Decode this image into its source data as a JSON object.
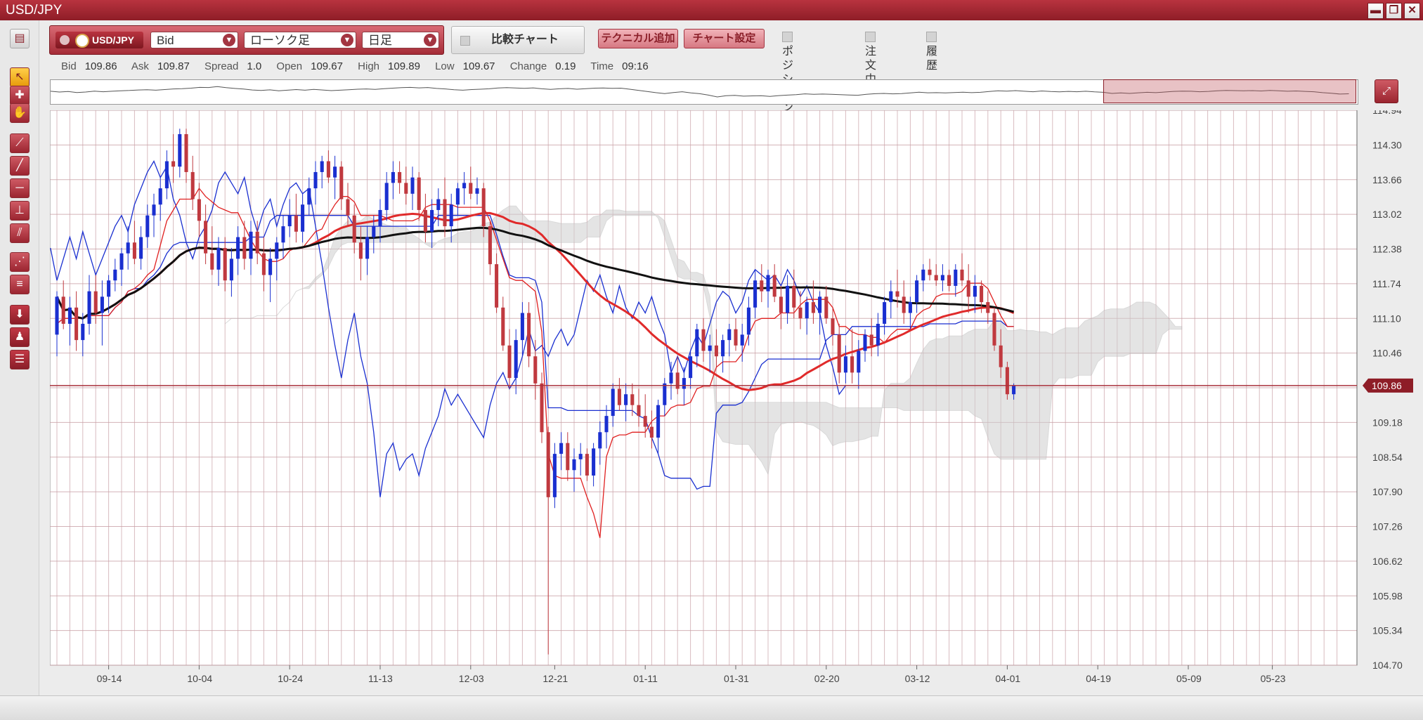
{
  "window": {
    "title": "USD/JPY",
    "controls": [
      "▬",
      "❐",
      "✕"
    ]
  },
  "toolbar": {
    "symbol": "USD/JPY",
    "price_type": "Bid",
    "chart_type": "ローソク足",
    "timeframe": "日足",
    "compare_label": "比較チャート",
    "add_technical_label": "テクニカル追加",
    "chart_settings_label": "チャート設定",
    "position_label": "ポジション",
    "orders_label": "注文中",
    "history_label": "履歴"
  },
  "quote": {
    "bid_label": "Bid",
    "bid": "109.86",
    "ask_label": "Ask",
    "ask": "109.87",
    "spread_label": "Spread",
    "spread": "1.0",
    "open_label": "Open",
    "open": "109.67",
    "high_label": "High",
    "high": "109.89",
    "low_label": "Low",
    "low": "109.67",
    "change_label": "Change",
    "change": "0.19",
    "time_label": "Time",
    "time": "09:16"
  },
  "left_tools": [
    "cursor-icon",
    "crosshair-icon",
    "hand-icon",
    "trendline-icon",
    "line-icon",
    "horizontal-line-icon",
    "vertical-line-icon",
    "channel-icon",
    "fibonacci-icon",
    "text-icon",
    "arrow-down-icon",
    "bell-icon",
    "list-icon"
  ],
  "chart_data": {
    "type": "candlestick",
    "symbol": "USD/JPY",
    "y_ticks": [
      "114.94",
      "114.30",
      "113.66",
      "113.02",
      "112.38",
      "111.74",
      "111.10",
      "110.46",
      "109.82",
      "109.18",
      "108.54",
      "107.90",
      "107.26",
      "106.62",
      "105.98",
      "105.34",
      "104.70"
    ],
    "ylim": [
      104.7,
      114.94
    ],
    "x_ticks": [
      "09-14",
      "10-04",
      "10-24",
      "11-13",
      "12-03",
      "12-21",
      "01-11",
      "01-31",
      "02-20",
      "03-12",
      "04-01",
      "04-19",
      "05-09",
      "05-23"
    ],
    "last_price_label": "109.86",
    "last_price": 109.86,
    "candles": [
      [
        110.8,
        111.6,
        110.4,
        111.5
      ],
      [
        111.5,
        111.8,
        110.9,
        111.0
      ],
      [
        111.0,
        111.5,
        110.6,
        111.3
      ],
      [
        111.3,
        111.6,
        110.5,
        110.7
      ],
      [
        110.7,
        111.2,
        110.4,
        111.0
      ],
      [
        111.0,
        111.9,
        110.8,
        111.6
      ],
      [
        111.6,
        111.9,
        111.0,
        111.2
      ],
      [
        111.2,
        111.8,
        110.6,
        111.5
      ],
      [
        111.5,
        111.9,
        111.2,
        111.8
      ],
      [
        111.8,
        112.2,
        111.6,
        112.0
      ],
      [
        112.0,
        112.4,
        111.7,
        112.3
      ],
      [
        112.3,
        112.8,
        112.0,
        112.5
      ],
      [
        112.5,
        112.9,
        112.1,
        112.2
      ],
      [
        112.2,
        112.8,
        112.0,
        112.6
      ],
      [
        112.6,
        113.2,
        112.4,
        113.0
      ],
      [
        113.0,
        113.4,
        112.6,
        113.2
      ],
      [
        113.2,
        113.7,
        112.9,
        113.5
      ],
      [
        113.5,
        114.2,
        113.3,
        114.0
      ],
      [
        114.0,
        114.5,
        113.6,
        113.9
      ],
      [
        113.9,
        114.6,
        113.7,
        114.5
      ],
      [
        114.5,
        114.6,
        113.6,
        113.8
      ],
      [
        113.8,
        114.1,
        113.1,
        113.3
      ],
      [
        113.3,
        113.6,
        112.6,
        112.9
      ],
      [
        112.9,
        113.2,
        112.1,
        112.3
      ],
      [
        112.3,
        112.8,
        111.9,
        112.0
      ],
      [
        112.0,
        112.6,
        111.7,
        112.4
      ],
      [
        112.4,
        112.6,
        111.6,
        111.8
      ],
      [
        111.8,
        112.4,
        111.5,
        112.2
      ],
      [
        112.2,
        112.8,
        111.9,
        112.6
      ],
      [
        112.6,
        112.9,
        112.0,
        112.2
      ],
      [
        112.2,
        112.9,
        111.9,
        112.7
      ],
      [
        112.7,
        112.9,
        112.1,
        112.3
      ],
      [
        112.3,
        112.6,
        111.6,
        111.9
      ],
      [
        111.9,
        112.4,
        111.4,
        112.2
      ],
      [
        112.2,
        112.6,
        111.8,
        112.5
      ],
      [
        112.5,
        113.0,
        112.2,
        112.8
      ],
      [
        112.8,
        113.3,
        112.6,
        113.0
      ],
      [
        113.0,
        113.4,
        112.5,
        112.7
      ],
      [
        112.7,
        113.4,
        112.5,
        113.2
      ],
      [
        113.2,
        113.7,
        113.0,
        113.5
      ],
      [
        113.5,
        114.0,
        113.2,
        113.8
      ],
      [
        113.8,
        114.1,
        113.5,
        114.0
      ],
      [
        114.0,
        114.2,
        113.6,
        113.7
      ],
      [
        113.7,
        114.1,
        113.3,
        113.9
      ],
      [
        113.9,
        114.0,
        113.1,
        113.3
      ],
      [
        113.3,
        113.6,
        112.8,
        113.0
      ],
      [
        113.0,
        113.2,
        112.3,
        112.5
      ],
      [
        112.5,
        112.8,
        111.8,
        112.2
      ],
      [
        112.2,
        112.8,
        111.9,
        112.6
      ],
      [
        112.6,
        113.0,
        112.3,
        112.8
      ],
      [
        112.8,
        113.3,
        112.5,
        113.1
      ],
      [
        113.1,
        113.8,
        112.9,
        113.6
      ],
      [
        113.6,
        114.0,
        113.3,
        113.8
      ],
      [
        113.8,
        114.0,
        113.4,
        113.6
      ],
      [
        113.6,
        113.9,
        113.2,
        113.4
      ],
      [
        113.4,
        113.9,
        113.1,
        113.7
      ],
      [
        113.7,
        113.8,
        112.9,
        113.1
      ],
      [
        113.1,
        113.4,
        112.5,
        112.7
      ],
      [
        112.7,
        113.3,
        112.4,
        113.1
      ],
      [
        113.1,
        113.5,
        112.8,
        113.3
      ],
      [
        113.3,
        113.7,
        112.6,
        112.8
      ],
      [
        112.8,
        113.4,
        112.5,
        113.2
      ],
      [
        113.2,
        113.6,
        113.0,
        113.5
      ],
      [
        113.5,
        113.8,
        113.2,
        113.6
      ],
      [
        113.6,
        113.9,
        113.3,
        113.4
      ],
      [
        113.4,
        113.7,
        113.2,
        113.5
      ],
      [
        113.5,
        113.6,
        112.6,
        112.8
      ],
      [
        112.8,
        112.9,
        111.9,
        112.1
      ],
      [
        112.1,
        112.3,
        111.2,
        111.3
      ],
      [
        111.3,
        111.5,
        110.5,
        110.6
      ],
      [
        110.6,
        110.9,
        109.8,
        110.0
      ],
      [
        110.0,
        110.9,
        109.7,
        110.7
      ],
      [
        110.7,
        111.4,
        110.4,
        111.2
      ],
      [
        111.2,
        111.4,
        110.2,
        110.4
      ],
      [
        110.4,
        110.7,
        109.6,
        109.9
      ],
      [
        109.9,
        110.1,
        108.8,
        109.0
      ],
      [
        109.0,
        109.1,
        104.9,
        107.8
      ],
      [
        107.8,
        108.8,
        107.6,
        108.6
      ],
      [
        108.6,
        109.0,
        108.3,
        108.8
      ],
      [
        108.8,
        109.0,
        108.1,
        108.3
      ],
      [
        108.3,
        108.7,
        107.9,
        108.5
      ],
      [
        108.5,
        108.8,
        108.2,
        108.6
      ],
      [
        108.6,
        108.7,
        108.1,
        108.2
      ],
      [
        108.2,
        108.8,
        108.0,
        108.7
      ],
      [
        108.7,
        109.2,
        108.4,
        109.0
      ],
      [
        109.0,
        109.5,
        108.7,
        109.3
      ],
      [
        109.3,
        109.9,
        109.1,
        109.8
      ],
      [
        109.8,
        110.0,
        109.4,
        109.5
      ],
      [
        109.5,
        109.9,
        109.2,
        109.7
      ],
      [
        109.7,
        109.9,
        109.3,
        109.5
      ],
      [
        109.5,
        109.8,
        109.1,
        109.3
      ],
      [
        109.3,
        109.7,
        108.9,
        109.1
      ],
      [
        109.1,
        109.4,
        108.7,
        108.9
      ],
      [
        108.9,
        109.6,
        108.6,
        109.5
      ],
      [
        109.5,
        110.0,
        109.3,
        109.9
      ],
      [
        109.9,
        110.3,
        109.6,
        110.1
      ],
      [
        110.1,
        110.4,
        109.7,
        109.8
      ],
      [
        109.8,
        110.2,
        109.5,
        110.0
      ],
      [
        110.0,
        110.5,
        109.8,
        110.4
      ],
      [
        110.4,
        111.0,
        110.2,
        110.9
      ],
      [
        110.9,
        111.1,
        110.3,
        110.5
      ],
      [
        110.5,
        110.8,
        110.1,
        110.6
      ],
      [
        110.6,
        110.9,
        110.2,
        110.4
      ],
      [
        110.4,
        110.8,
        110.1,
        110.7
      ],
      [
        110.7,
        111.0,
        110.4,
        110.9
      ],
      [
        110.9,
        111.1,
        110.5,
        110.6
      ],
      [
        110.6,
        111.0,
        110.3,
        110.8
      ],
      [
        110.8,
        111.5,
        110.6,
        111.3
      ],
      [
        111.3,
        112.0,
        111.1,
        111.8
      ],
      [
        111.8,
        112.1,
        111.4,
        111.6
      ],
      [
        111.6,
        112.0,
        111.3,
        111.9
      ],
      [
        111.9,
        112.1,
        111.4,
        111.5
      ],
      [
        111.5,
        111.7,
        110.9,
        111.2
      ],
      [
        111.2,
        111.9,
        111.0,
        111.7
      ],
      [
        111.7,
        112.0,
        111.1,
        111.3
      ],
      [
        111.3,
        111.6,
        110.9,
        111.1
      ],
      [
        111.1,
        111.5,
        110.8,
        111.4
      ],
      [
        111.4,
        111.8,
        111.0,
        111.2
      ],
      [
        111.2,
        111.6,
        110.8,
        111.5
      ],
      [
        111.5,
        111.7,
        111.0,
        111.1
      ],
      [
        111.1,
        111.3,
        110.6,
        110.8
      ],
      [
        110.8,
        111.0,
        109.9,
        110.1
      ],
      [
        110.1,
        110.6,
        109.9,
        110.4
      ],
      [
        110.4,
        110.9,
        109.9,
        110.1
      ],
      [
        110.1,
        110.7,
        109.8,
        110.5
      ],
      [
        110.5,
        110.9,
        110.3,
        110.8
      ],
      [
        110.8,
        111.1,
        110.4,
        110.6
      ],
      [
        110.6,
        111.2,
        110.4,
        111.0
      ],
      [
        111.0,
        111.5,
        110.8,
        111.4
      ],
      [
        111.4,
        111.8,
        111.1,
        111.6
      ],
      [
        111.6,
        112.0,
        111.3,
        111.5
      ],
      [
        111.5,
        111.8,
        111.0,
        111.2
      ],
      [
        111.2,
        111.5,
        110.9,
        111.4
      ],
      [
        111.4,
        111.9,
        111.2,
        111.8
      ],
      [
        111.8,
        112.1,
        111.6,
        112.0
      ],
      [
        112.0,
        112.2,
        111.8,
        111.9
      ],
      [
        111.9,
        112.1,
        111.7,
        111.8
      ],
      [
        111.8,
        112.1,
        111.6,
        111.9
      ],
      [
        111.9,
        112.0,
        111.6,
        111.7
      ],
      [
        111.7,
        112.1,
        111.5,
        112.0
      ],
      [
        112.0,
        112.3,
        111.7,
        111.8
      ],
      [
        111.8,
        112.1,
        111.2,
        111.5
      ],
      [
        111.5,
        111.9,
        111.2,
        111.7
      ],
      [
        111.7,
        111.8,
        111.2,
        111.4
      ],
      [
        111.4,
        111.6,
        111.0,
        111.2
      ],
      [
        111.2,
        111.3,
        110.5,
        110.6
      ],
      [
        110.6,
        110.9,
        110.0,
        110.2
      ],
      [
        110.2,
        110.3,
        109.6,
        109.7
      ],
      [
        109.7,
        109.9,
        109.6,
        109.86
      ]
    ],
    "x_tick_index": [
      8,
      22,
      36,
      50,
      64,
      77,
      91,
      105,
      119,
      133,
      147,
      161,
      175,
      188
    ]
  }
}
